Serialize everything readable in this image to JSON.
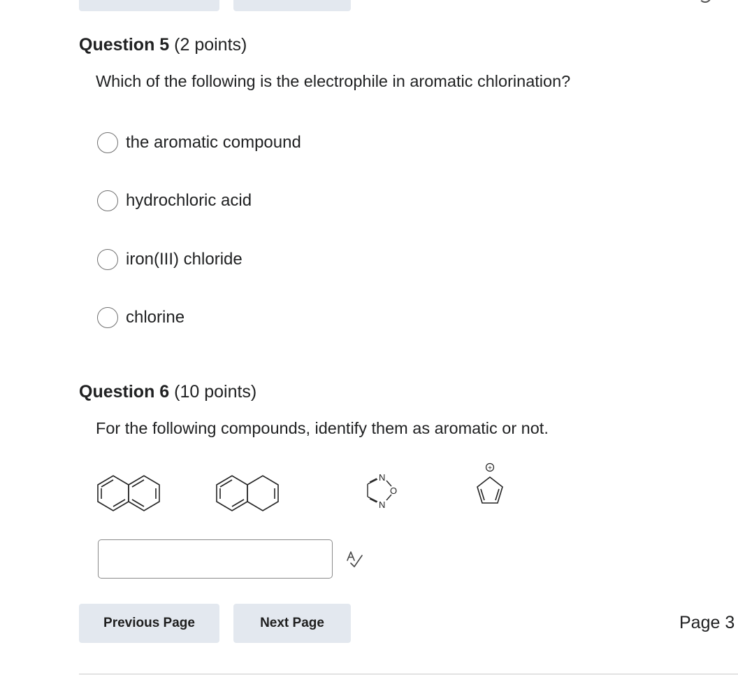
{
  "question5": {
    "label": "Question 5",
    "points": "(2 points)",
    "text": "Which of the following is the electrophile in aromatic chlorination?",
    "options": [
      {
        "label": "the aromatic compound",
        "selected": false
      },
      {
        "label": "hydrochloric acid",
        "selected": false
      },
      {
        "label": "iron(III) chloride",
        "selected": false
      },
      {
        "label": "chlorine",
        "selected": false
      }
    ]
  },
  "question6": {
    "label": "Question 6",
    "points": "(10 points)",
    "text": "For the following compounds, identify them as aromatic or not.",
    "structures": [
      "naphthalene-structure",
      "dihydronaphthalene-structure",
      "oxadiazole-structure",
      "cyclopentadienyl-cation-structure"
    ],
    "structure_labels": {
      "n_top": "N",
      "o_right": "O",
      "n_bottom": "N",
      "charge": "+"
    },
    "answer_value": "",
    "spellcheck_icon": "spellcheck-icon"
  },
  "navigation": {
    "previous_label": "Previous Page",
    "next_label": "Next Page",
    "page_label": "Page 3"
  }
}
